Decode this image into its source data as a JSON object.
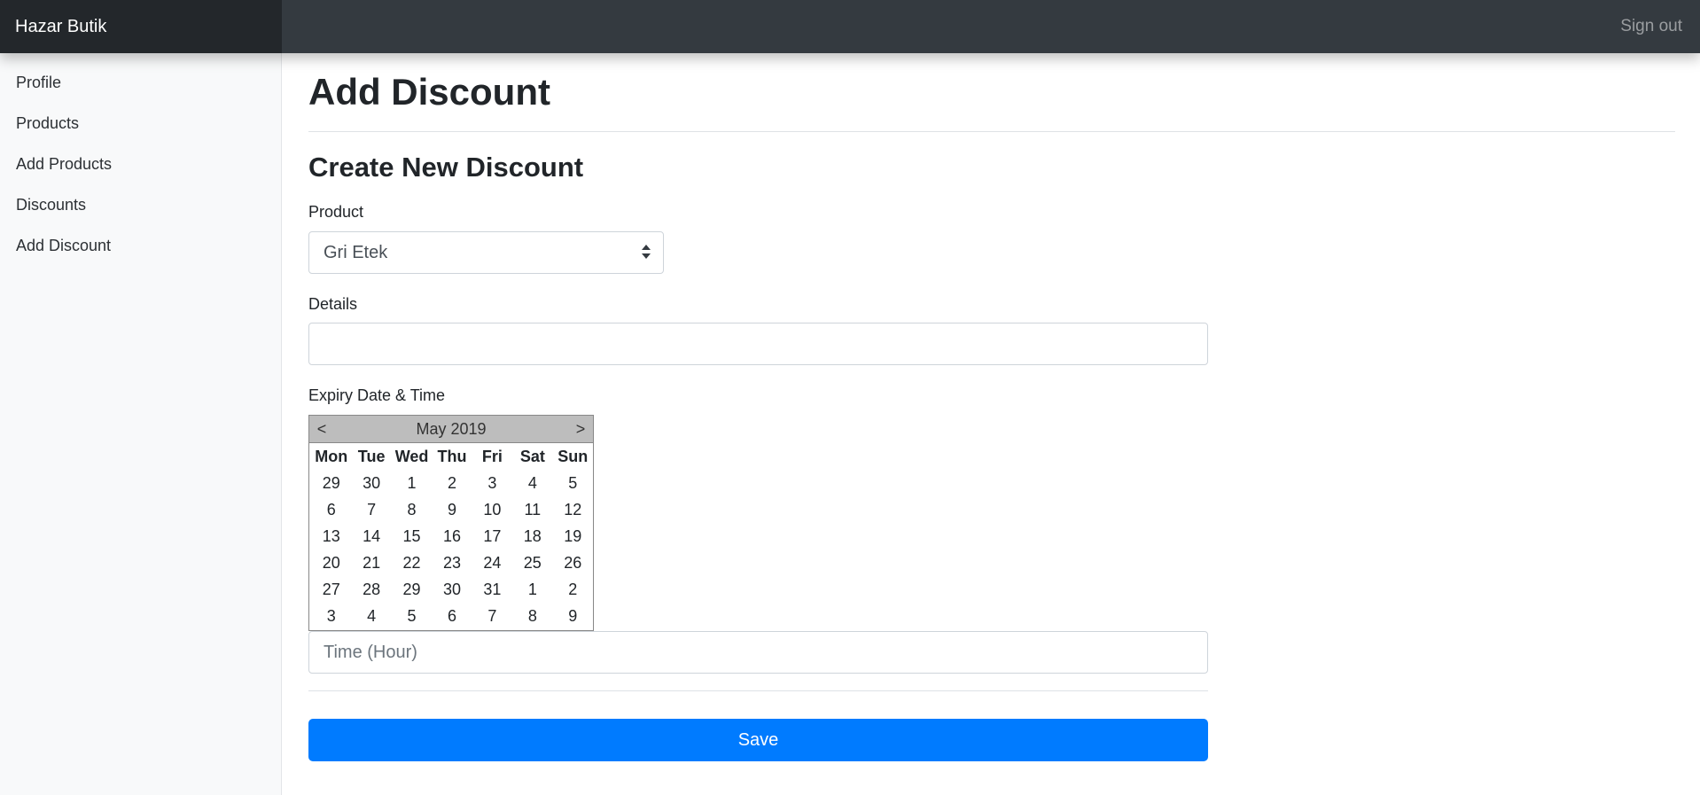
{
  "header": {
    "brand": "Hazar Butik",
    "sign_out": "Sign out"
  },
  "sidebar": {
    "items": [
      {
        "label": "Profile"
      },
      {
        "label": "Products"
      },
      {
        "label": "Add Products"
      },
      {
        "label": "Discounts"
      },
      {
        "label": "Add Discount"
      }
    ]
  },
  "main": {
    "page_title": "Add Discount",
    "section_title": "Create New Discount",
    "product_label": "Product",
    "product_value": "Gri Etek",
    "details_label": "Details",
    "details_value": "",
    "expiry_label": "Expiry Date & Time",
    "time_placeholder": "Time (Hour)",
    "save_label": "Save"
  },
  "calendar": {
    "month_label": "May 2019",
    "prev": "<",
    "next": ">",
    "weekdays": [
      "Mon",
      "Tue",
      "Wed",
      "Thu",
      "Fri",
      "Sat",
      "Sun"
    ],
    "weeks": [
      [
        "29",
        "30",
        "1",
        "2",
        "3",
        "4",
        "5"
      ],
      [
        "6",
        "7",
        "8",
        "9",
        "10",
        "11",
        "12"
      ],
      [
        "13",
        "14",
        "15",
        "16",
        "17",
        "18",
        "19"
      ],
      [
        "20",
        "21",
        "22",
        "23",
        "24",
        "25",
        "26"
      ],
      [
        "27",
        "28",
        "29",
        "30",
        "31",
        "1",
        "2"
      ],
      [
        "3",
        "4",
        "5",
        "6",
        "7",
        "8",
        "9"
      ]
    ]
  },
  "colors": {
    "navbar": "#343a40",
    "brand_bg": "#23272b",
    "primary": "#007bff",
    "sidebar_bg": "#f8f9fa",
    "calendar_header": "#bdbdbd"
  }
}
